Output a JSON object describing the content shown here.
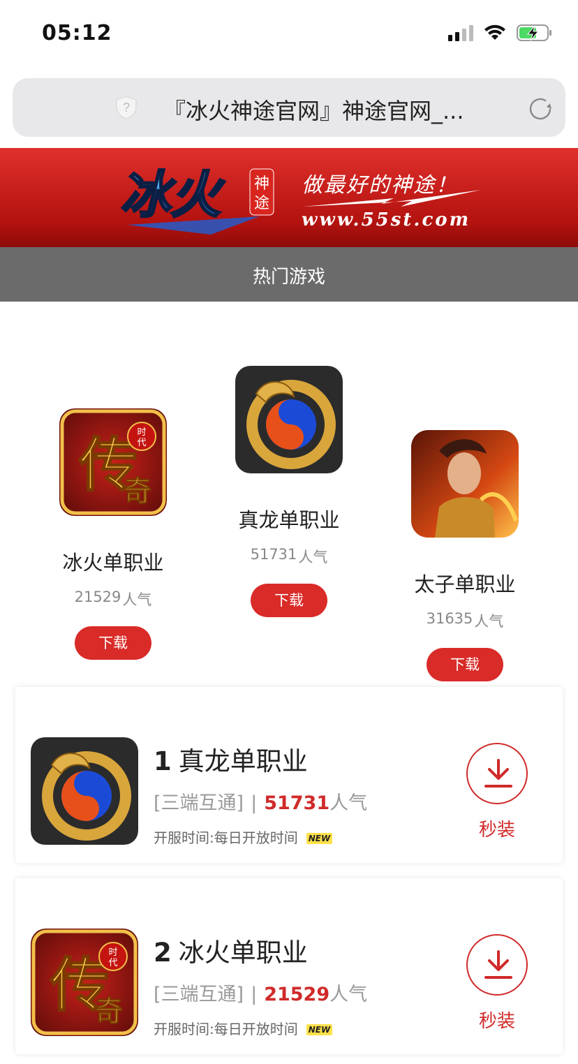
{
  "status_bar": {
    "time": "05:12"
  },
  "browser": {
    "url_title": "『冰火神途官网』神途官网_..."
  },
  "banner": {
    "logo_main": "冰火",
    "logo_tag": "神途",
    "slogan": "做最好的神途！",
    "site": "www.55st.com"
  },
  "section": {
    "title": "热门游戏"
  },
  "top_games": [
    {
      "name": "冰火单职业",
      "popularity": "21529",
      "pop_suffix": "人气",
      "button": "下载",
      "icon": "legend-era-icon"
    },
    {
      "name": "真龙单职业",
      "popularity": "51731",
      "pop_suffix": "人气",
      "button": "下载",
      "icon": "dragon-yinyang-icon"
    },
    {
      "name": "太子单职业",
      "popularity": "31635",
      "pop_suffix": "人气",
      "button": "下载",
      "icon": "warrior-hero-icon"
    }
  ],
  "ranked_games": [
    {
      "rank": "1",
      "name": "真龙单职业",
      "tag": "[三端互通]",
      "separator": "|",
      "popularity": "51731",
      "pop_suffix": "人气",
      "open_time": "开服时间:每日开放时间",
      "badge": "NEW",
      "action": "秒装",
      "icon": "dragon-yinyang-icon"
    },
    {
      "rank": "2",
      "name": "冰火单职业",
      "tag": "[三端互通]",
      "separator": "|",
      "popularity": "21529",
      "pop_suffix": "人气",
      "open_time": "开服时间:每日开放时间",
      "badge": "NEW",
      "action": "秒装",
      "icon": "legend-era-icon"
    }
  ],
  "colors": {
    "accent": "#d92b28",
    "header_gray": "#6b6b6b",
    "banner_red": "#c81d1a"
  }
}
